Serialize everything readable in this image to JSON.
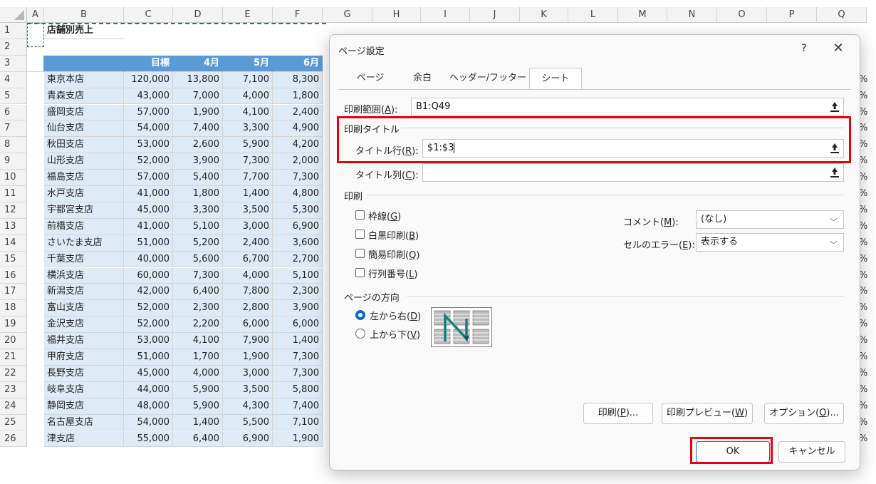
{
  "columns": [
    "A",
    "B",
    "C",
    "D",
    "E",
    "F",
    "G",
    "H",
    "I",
    "J",
    "K",
    "L",
    "M",
    "N",
    "O",
    "P",
    "Q"
  ],
  "sheet_title": "店舗別売上",
  "header_row": [
    "",
    "目標",
    "4月",
    "5月",
    "6月"
  ],
  "rows": [
    [
      "東京本店",
      "120,000",
      "13,800",
      "7,100",
      "8,300"
    ],
    [
      "青森支店",
      "43,000",
      "7,000",
      "4,000",
      "1,800"
    ],
    [
      "盛岡支店",
      "57,000",
      "1,900",
      "4,100",
      "2,400"
    ],
    [
      "仙台支店",
      "54,000",
      "7,400",
      "3,300",
      "4,900"
    ],
    [
      "秋田支店",
      "53,000",
      "2,600",
      "5,900",
      "4,200"
    ],
    [
      "山形支店",
      "52,000",
      "3,900",
      "7,300",
      "2,000"
    ],
    [
      "福島支店",
      "57,000",
      "5,400",
      "7,700",
      "7,300"
    ],
    [
      "水戸支店",
      "41,000",
      "1,800",
      "1,400",
      "4,800"
    ],
    [
      "宇都宮支店",
      "45,000",
      "3,300",
      "3,500",
      "5,300"
    ],
    [
      "前橋支店",
      "41,000",
      "5,100",
      "3,000",
      "6,900"
    ],
    [
      "さいたま支店",
      "51,000",
      "5,200",
      "2,400",
      "3,600"
    ],
    [
      "千葉支店",
      "40,000",
      "5,600",
      "6,700",
      "2,700"
    ],
    [
      "横浜支店",
      "60,000",
      "7,300",
      "4,000",
      "5,100"
    ],
    [
      "新潟支店",
      "42,000",
      "6,400",
      "7,800",
      "2,300"
    ],
    [
      "富山支店",
      "52,000",
      "2,300",
      "2,800",
      "3,900"
    ],
    [
      "金沢支店",
      "52,000",
      "2,200",
      "6,000",
      "6,000"
    ],
    [
      "福井支店",
      "53,000",
      "4,100",
      "7,900",
      "1,400"
    ],
    [
      "甲府支店",
      "51,000",
      "1,700",
      "1,900",
      "7,300"
    ],
    [
      "長野支店",
      "45,000",
      "4,000",
      "3,000",
      "7,300"
    ],
    [
      "岐阜支店",
      "44,000",
      "5,900",
      "3,500",
      "5,800"
    ],
    [
      "静岡支店",
      "48,000",
      "5,900",
      "4,300",
      "7,400"
    ],
    [
      "名古屋支店",
      "54,000",
      "1,400",
      "5,500",
      "7,100"
    ],
    [
      "津支店",
      "55,000",
      "6,400",
      "6,900",
      "1,900"
    ]
  ],
  "row_numbers": [
    "1",
    "2",
    "3",
    "4",
    "5",
    "6",
    "7",
    "8",
    "9",
    "10",
    "11",
    "12",
    "13",
    "14",
    "15",
    "16",
    "17",
    "18",
    "19",
    "20",
    "21",
    "22",
    "23",
    "24",
    "25",
    "26"
  ],
  "pct_suffix": "%",
  "dialog": {
    "title": "ページ設定",
    "help": "?",
    "close": "✕",
    "tabs": [
      "ページ",
      "余白",
      "ヘッダー/フッター",
      "シート"
    ],
    "print_area_label_a": "印刷範囲(",
    "print_area_key": "A",
    "print_area_label_b": "):",
    "print_area_value": "B1:Q49",
    "print_titles_group": "印刷タイトル",
    "title_rows_label_a": "タイトル行(",
    "title_rows_key": "R",
    "title_rows_label_b": "):",
    "title_rows_value": "$1:$3",
    "title_cols_label_a": "タイトル列(",
    "title_cols_key": "C",
    "title_cols_label_b": "):",
    "title_cols_value": "",
    "print_group": "印刷",
    "checkboxes": [
      {
        "a": "枠線(",
        "k": "G",
        "b": ")"
      },
      {
        "a": "白黒印刷(",
        "k": "B",
        "b": ")"
      },
      {
        "a": "簡易印刷(",
        "k": "Q",
        "b": ")"
      },
      {
        "a": "行列番号(",
        "k": "L",
        "b": ")"
      }
    ],
    "comment_label_a": "コメント(",
    "comment_key": "M",
    "comment_label_b": "):",
    "comment_value": "(なし)",
    "error_label_a": "セルのエラー(",
    "error_key": "E",
    "error_label_b": "):",
    "error_value": "表示する",
    "order_group": "ページの方向",
    "order_options": [
      {
        "a": "左から右(",
        "k": "D",
        "b": ")",
        "selected": true
      },
      {
        "a": "上から下(",
        "k": "V",
        "b": ")",
        "selected": false
      }
    ],
    "print_btn": {
      "a": "印刷(",
      "k": "P",
      "b": ")..."
    },
    "preview_btn": {
      "a": "印刷プレビュー(",
      "k": "W",
      "b": ")"
    },
    "options_btn": {
      "a": "オプション(",
      "k": "O",
      "b": ")..."
    },
    "ok": "OK",
    "cancel": "キャンセル"
  },
  "colors": {
    "header_blue": "#5b9bd5",
    "band": "#ddebf7",
    "highlight_red": "#e3000f",
    "accent": "#0e6ac7"
  }
}
